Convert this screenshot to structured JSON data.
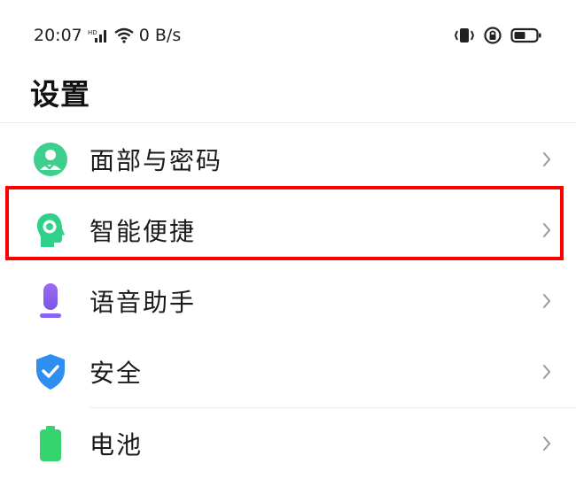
{
  "status_bar": {
    "time": "20:07",
    "network_speed": "0 B/s",
    "icons": [
      "signal-icon",
      "wifi-icon",
      "vibrate-icon",
      "rotation-lock-icon",
      "battery-icon"
    ]
  },
  "page": {
    "title": "设置"
  },
  "settings_items": [
    {
      "label": "面部与密码",
      "icon": "face-password-icon",
      "color": "#3ccf8e"
    },
    {
      "label": "智能便捷",
      "icon": "smart-assist-icon",
      "color": "#2fd18a"
    },
    {
      "label": "语音助手",
      "icon": "microphone-icon",
      "color": "#8a63f0"
    },
    {
      "label": "安全",
      "icon": "shield-check-icon",
      "color": "#2e8ff0"
    },
    {
      "label": "电池",
      "icon": "battery-setting-icon",
      "color": "#35d46f"
    }
  ],
  "highlight": {
    "target": "settings_items.1",
    "color": "#ff0000"
  }
}
